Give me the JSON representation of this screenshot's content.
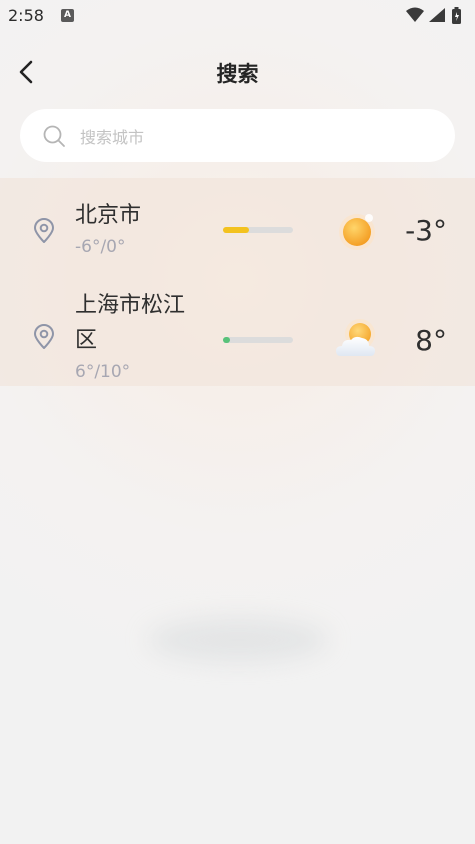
{
  "status_bar": {
    "time": "2:58",
    "app_badge": "A"
  },
  "header": {
    "title": "搜索"
  },
  "search": {
    "placeholder": "搜索城市"
  },
  "results": [
    {
      "city": "北京市",
      "range": "-6°/0°",
      "temp": "-3°",
      "bar_fill_fraction": 0.37,
      "bar_color": "#f3c21f",
      "icon": "sunny-icon"
    },
    {
      "city": "上海市松江区",
      "range": "6°/10°",
      "temp": "8°",
      "bar_fill_fraction": 0.1,
      "bar_color": "#58c27a",
      "icon": "partly-cloudy-icon"
    }
  ]
}
